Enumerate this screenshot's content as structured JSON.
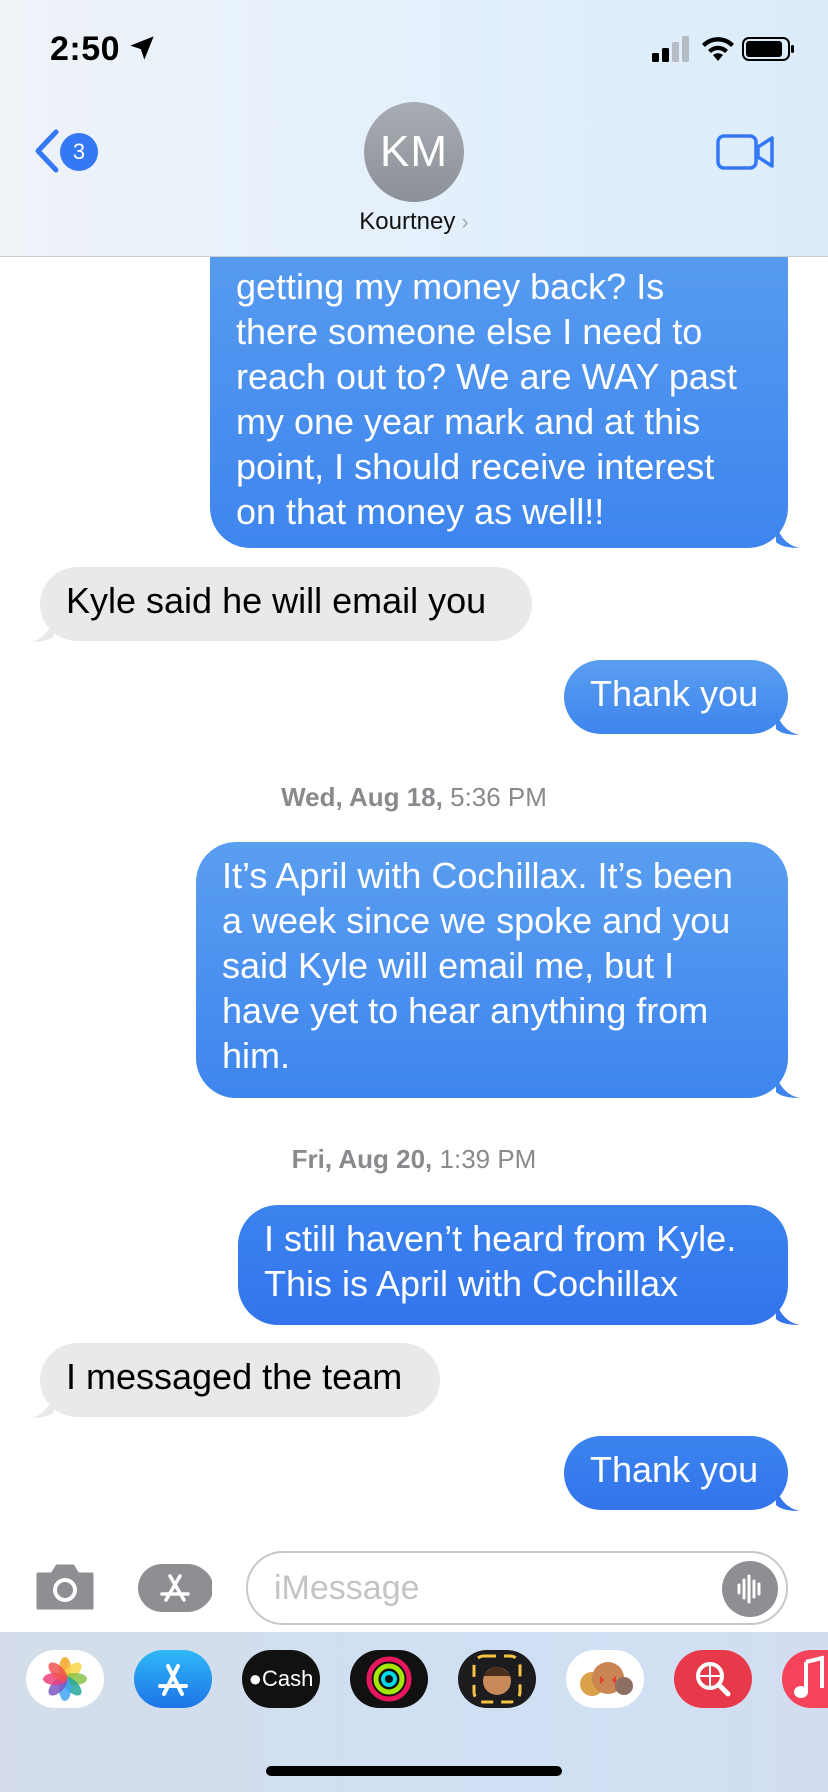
{
  "status_bar": {
    "time": "2:50"
  },
  "header": {
    "back_badge": "3",
    "avatar_initials": "KM",
    "contact_name": "Kourtney",
    "icons": [
      "chevron-left-icon",
      "video-camera-icon"
    ]
  },
  "colors": {
    "accent": "#3478f6",
    "outgoing_bubble": "#3e85ee",
    "incoming_bubble": "#e9e9eb"
  },
  "messages": [
    {
      "type": "outgoing",
      "lines": [
        "getting my money back? Is",
        "there someone else I need to",
        "reach out to? We are WAY past",
        "my one year mark and at this",
        "point, I should receive interest",
        "on that money as well!!"
      ]
    },
    {
      "type": "incoming",
      "text": "Kyle said he will email you"
    },
    {
      "type": "outgoing",
      "text": "Thank you"
    },
    {
      "type": "timestamp",
      "day": "Wed, Aug 18,",
      "time": "5:36 PM"
    },
    {
      "type": "outgoing",
      "lines": [
        "It’s April with Cochillax. It’s been",
        "a week since we spoke and you",
        "said Kyle will email me, but I",
        "have yet to hear anything from",
        "him."
      ]
    },
    {
      "type": "timestamp",
      "day": "Fri, Aug 20,",
      "time": "1:39 PM"
    },
    {
      "type": "outgoing",
      "lines": [
        "I still haven’t heard from Kyle.",
        "This is April with Cochillax"
      ]
    },
    {
      "type": "incoming",
      "text": "I messaged the team"
    },
    {
      "type": "outgoing",
      "text": "Thank you"
    }
  ],
  "input": {
    "placeholder": "iMessage"
  },
  "app_drawer": {
    "apps": [
      "photos-app-icon",
      "app-store-icon",
      "apple-cash-app-icon",
      "activity-app-icon",
      "memoji-app-icon",
      "memoji-stickers-app-icon",
      "search-images-app-icon",
      "music-app-icon"
    ],
    "cash_label": "Cash"
  }
}
